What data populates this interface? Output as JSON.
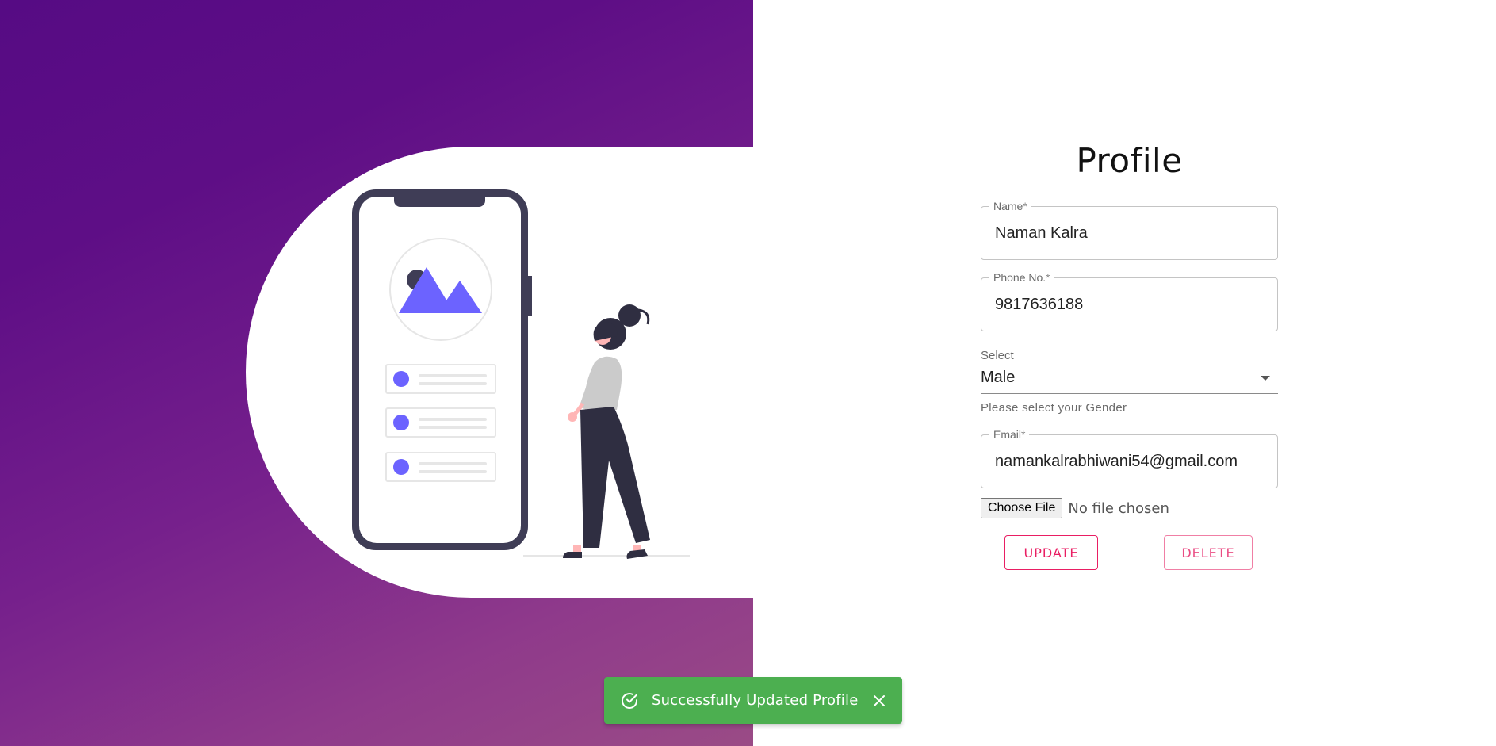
{
  "page": {
    "title": "Profile"
  },
  "form": {
    "name": {
      "label": "Name",
      "required_mark": "*",
      "value": "Naman Kalra"
    },
    "phone": {
      "label": "Phone No.",
      "required_mark": "*",
      "value": "9817636188"
    },
    "gender": {
      "label": "Select",
      "value": "Male",
      "helper": "Please select your Gender"
    },
    "email": {
      "label": "Email",
      "required_mark": "*",
      "value": "namankalrabhiwani54@gmail.com"
    },
    "file": {
      "button_label": "Choose File",
      "status": "No file chosen"
    }
  },
  "actions": {
    "update_label": "UPDATE",
    "delete_label": "DELETE"
  },
  "toast": {
    "message": "Successfully Updated Profile",
    "icon": "check-circle-icon",
    "close_icon": "close-icon",
    "color": "#4caf50"
  },
  "colors": {
    "gradient_start": "#560b84",
    "gradient_end": "#9a4b86",
    "accent": "#e91e63",
    "illustration_primary": "#6c63ff",
    "illustration_dark": "#3f3d56"
  }
}
